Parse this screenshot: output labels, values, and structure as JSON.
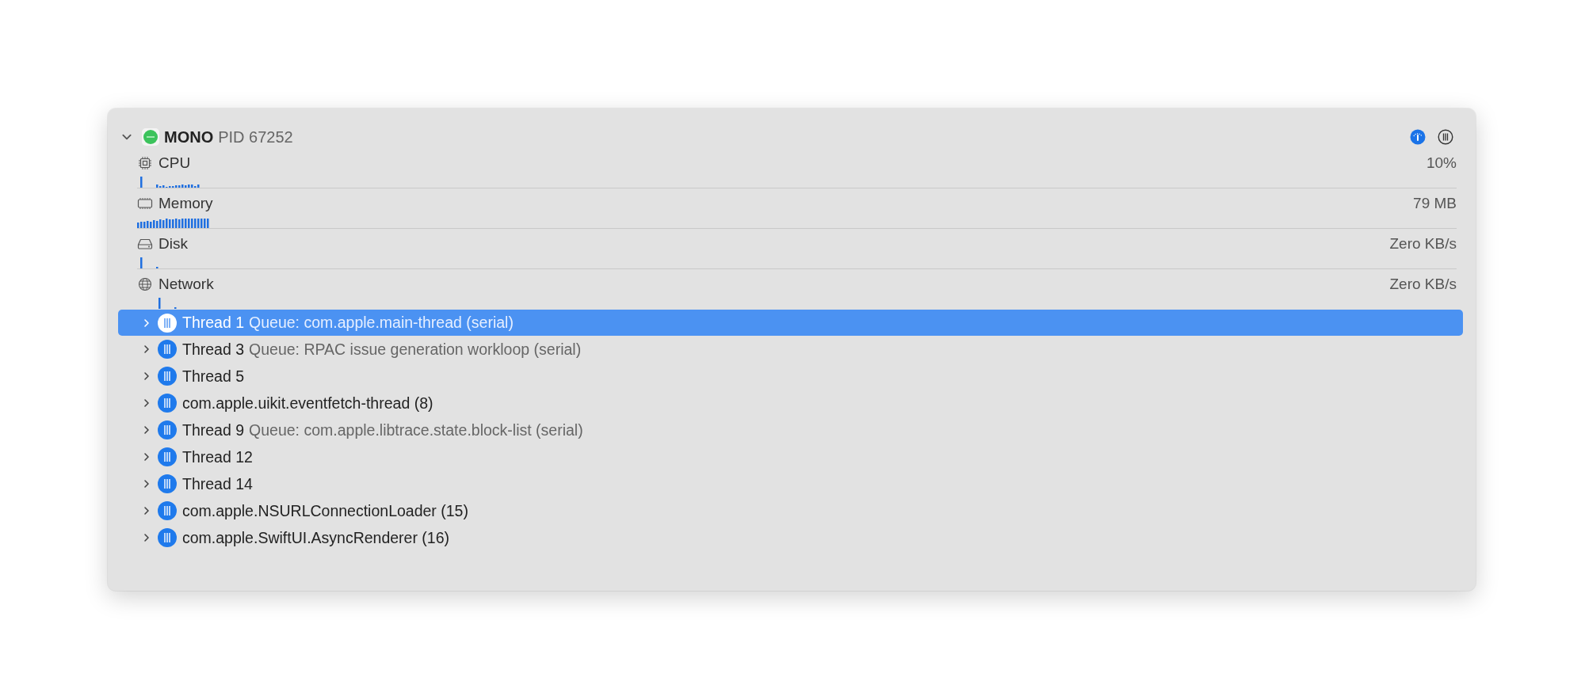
{
  "process": {
    "name": "MONO",
    "pid": "PID 67252",
    "expanded": true
  },
  "gauges": [
    {
      "kind": "cpu",
      "label": "CPU",
      "reading": "10%"
    },
    {
      "kind": "memory",
      "label": "Memory",
      "reading": "79 MB"
    },
    {
      "kind": "disk",
      "label": "Disk",
      "reading": "Zero KB/s"
    },
    {
      "kind": "network",
      "label": "Network",
      "reading": "Zero KB/s"
    }
  ],
  "threads": [
    {
      "name": "Thread 1",
      "queue": "Queue: com.apple.main-thread (serial)",
      "selected": true,
      "expanded": false
    },
    {
      "name": "Thread 3",
      "queue": "Queue: RPAC issue generation workloop (serial)",
      "selected": false,
      "expanded": false
    },
    {
      "name": "Thread 5",
      "selected": false,
      "expanded": false
    },
    {
      "name": "com.apple.uikit.eventfetch-thread (8)",
      "selected": false,
      "expanded": false
    },
    {
      "name": "Thread 9",
      "queue": "Queue: com.apple.libtrace.state.block-list (serial)",
      "selected": false,
      "expanded": false
    },
    {
      "name": "Thread 12",
      "selected": false,
      "expanded": false
    },
    {
      "name": "Thread 14",
      "selected": false,
      "expanded": false
    },
    {
      "name": "com.apple.NSURLConnectionLoader (15)",
      "selected": false,
      "expanded": false
    },
    {
      "name": "com.apple.SwiftUI.AsyncRenderer (16)",
      "selected": false,
      "expanded": false
    }
  ]
}
